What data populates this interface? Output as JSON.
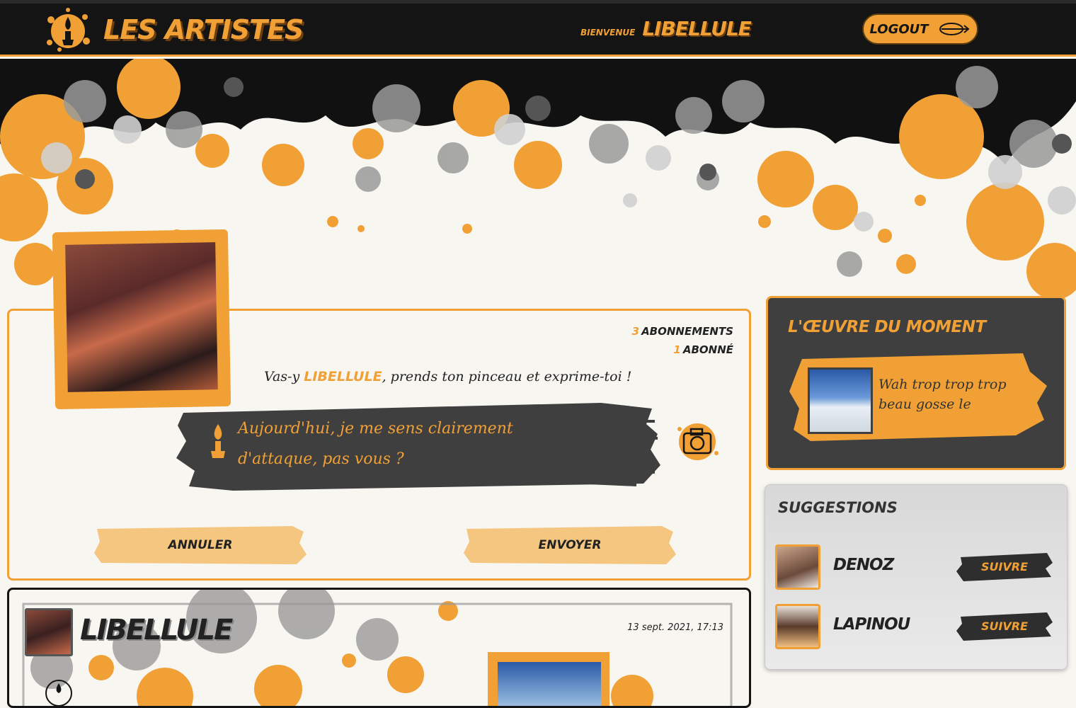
{
  "header": {
    "brand": "LES ARTISTES",
    "welcome_label": "BIENVENUE",
    "username": "LIBELLULE",
    "logout_label": "LOGOUT"
  },
  "profile": {
    "following_count": "3",
    "following_label": "ABONNEMENTS",
    "followers_count": "1",
    "followers_label": "ABONNÉ",
    "prompt_prefix": "Vas-y ",
    "prompt_user": "LIBELLULE",
    "prompt_suffix": ", prends ton pinceau et exprime-toi !",
    "composer_text": "Aujourd'hui, je me sens clairement d'attaque, pas vous ?",
    "cancel_label": "ANNULER",
    "send_label": "ENVOYER"
  },
  "featured": {
    "title": "L'ŒUVRE DU MOMENT",
    "text": "Wah trop trop trop beau gosse le"
  },
  "suggestions": {
    "title": "SUGGESTIONS",
    "items": [
      {
        "name": "DENOZ",
        "follow_label": "SUIVRE"
      },
      {
        "name": "LAPINOU",
        "follow_label": "SUIVRE"
      }
    ]
  },
  "feed": {
    "author": "LIBELLULE",
    "date": "13 sept. 2021, 17:13"
  },
  "colors": {
    "accent": "#f0a035",
    "dark": "#141414",
    "panel": "#3f3f3f",
    "paper": "#f8f6f1"
  }
}
